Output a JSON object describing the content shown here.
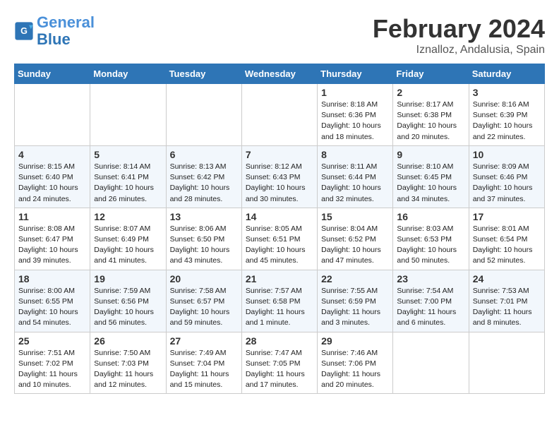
{
  "header": {
    "logo_line1": "General",
    "logo_line2": "Blue",
    "month": "February 2024",
    "location": "Iznalloz, Andalusia, Spain"
  },
  "weekdays": [
    "Sunday",
    "Monday",
    "Tuesday",
    "Wednesday",
    "Thursday",
    "Friday",
    "Saturday"
  ],
  "weeks": [
    [
      {
        "day": null
      },
      {
        "day": null
      },
      {
        "day": null
      },
      {
        "day": null
      },
      {
        "day": "1",
        "sunrise": "8:18 AM",
        "sunset": "6:36 PM",
        "daylight": "10 hours and 18 minutes."
      },
      {
        "day": "2",
        "sunrise": "8:17 AM",
        "sunset": "6:38 PM",
        "daylight": "10 hours and 20 minutes."
      },
      {
        "day": "3",
        "sunrise": "8:16 AM",
        "sunset": "6:39 PM",
        "daylight": "10 hours and 22 minutes."
      }
    ],
    [
      {
        "day": "4",
        "sunrise": "8:15 AM",
        "sunset": "6:40 PM",
        "daylight": "10 hours and 24 minutes."
      },
      {
        "day": "5",
        "sunrise": "8:14 AM",
        "sunset": "6:41 PM",
        "daylight": "10 hours and 26 minutes."
      },
      {
        "day": "6",
        "sunrise": "8:13 AM",
        "sunset": "6:42 PM",
        "daylight": "10 hours and 28 minutes."
      },
      {
        "day": "7",
        "sunrise": "8:12 AM",
        "sunset": "6:43 PM",
        "daylight": "10 hours and 30 minutes."
      },
      {
        "day": "8",
        "sunrise": "8:11 AM",
        "sunset": "6:44 PM",
        "daylight": "10 hours and 32 minutes."
      },
      {
        "day": "9",
        "sunrise": "8:10 AM",
        "sunset": "6:45 PM",
        "daylight": "10 hours and 34 minutes."
      },
      {
        "day": "10",
        "sunrise": "8:09 AM",
        "sunset": "6:46 PM",
        "daylight": "10 hours and 37 minutes."
      }
    ],
    [
      {
        "day": "11",
        "sunrise": "8:08 AM",
        "sunset": "6:47 PM",
        "daylight": "10 hours and 39 minutes."
      },
      {
        "day": "12",
        "sunrise": "8:07 AM",
        "sunset": "6:49 PM",
        "daylight": "10 hours and 41 minutes."
      },
      {
        "day": "13",
        "sunrise": "8:06 AM",
        "sunset": "6:50 PM",
        "daylight": "10 hours and 43 minutes."
      },
      {
        "day": "14",
        "sunrise": "8:05 AM",
        "sunset": "6:51 PM",
        "daylight": "10 hours and 45 minutes."
      },
      {
        "day": "15",
        "sunrise": "8:04 AM",
        "sunset": "6:52 PM",
        "daylight": "10 hours and 47 minutes."
      },
      {
        "day": "16",
        "sunrise": "8:03 AM",
        "sunset": "6:53 PM",
        "daylight": "10 hours and 50 minutes."
      },
      {
        "day": "17",
        "sunrise": "8:01 AM",
        "sunset": "6:54 PM",
        "daylight": "10 hours and 52 minutes."
      }
    ],
    [
      {
        "day": "18",
        "sunrise": "8:00 AM",
        "sunset": "6:55 PM",
        "daylight": "10 hours and 54 minutes."
      },
      {
        "day": "19",
        "sunrise": "7:59 AM",
        "sunset": "6:56 PM",
        "daylight": "10 hours and 56 minutes."
      },
      {
        "day": "20",
        "sunrise": "7:58 AM",
        "sunset": "6:57 PM",
        "daylight": "10 hours and 59 minutes."
      },
      {
        "day": "21",
        "sunrise": "7:57 AM",
        "sunset": "6:58 PM",
        "daylight": "11 hours and 1 minute."
      },
      {
        "day": "22",
        "sunrise": "7:55 AM",
        "sunset": "6:59 PM",
        "daylight": "11 hours and 3 minutes."
      },
      {
        "day": "23",
        "sunrise": "7:54 AM",
        "sunset": "7:00 PM",
        "daylight": "11 hours and 6 minutes."
      },
      {
        "day": "24",
        "sunrise": "7:53 AM",
        "sunset": "7:01 PM",
        "daylight": "11 hours and 8 minutes."
      }
    ],
    [
      {
        "day": "25",
        "sunrise": "7:51 AM",
        "sunset": "7:02 PM",
        "daylight": "11 hours and 10 minutes."
      },
      {
        "day": "26",
        "sunrise": "7:50 AM",
        "sunset": "7:03 PM",
        "daylight": "11 hours and 12 minutes."
      },
      {
        "day": "27",
        "sunrise": "7:49 AM",
        "sunset": "7:04 PM",
        "daylight": "11 hours and 15 minutes."
      },
      {
        "day": "28",
        "sunrise": "7:47 AM",
        "sunset": "7:05 PM",
        "daylight": "11 hours and 17 minutes."
      },
      {
        "day": "29",
        "sunrise": "7:46 AM",
        "sunset": "7:06 PM",
        "daylight": "11 hours and 20 minutes."
      },
      {
        "day": null
      },
      {
        "day": null
      }
    ]
  ]
}
